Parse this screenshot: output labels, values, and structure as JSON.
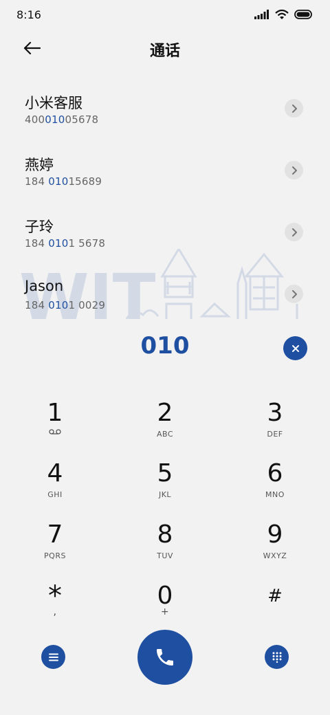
{
  "status": {
    "time": "8:16"
  },
  "header": {
    "title": "通话"
  },
  "contacts": [
    {
      "name": "小米客服",
      "number_parts": [
        "400",
        "010",
        "05678"
      ]
    },
    {
      "name": "燕婷",
      "number_parts": [
        "184 ",
        "010",
        "15689"
      ]
    },
    {
      "name": "子玲",
      "number_parts": [
        "184 ",
        "010",
        "1 5678"
      ]
    },
    {
      "name": "Jason",
      "number_parts": [
        "184 ",
        "010",
        "1 0029"
      ]
    }
  ],
  "watermark": {
    "text": "WIT"
  },
  "dialer": {
    "typed_number": "010",
    "keys": [
      {
        "digit": "1",
        "letters": "",
        "icon": "voicemail-icon"
      },
      {
        "digit": "2",
        "letters": "ABC"
      },
      {
        "digit": "3",
        "letters": "DEF"
      },
      {
        "digit": "4",
        "letters": "GHI"
      },
      {
        "digit": "5",
        "letters": "JKL"
      },
      {
        "digit": "6",
        "letters": "MNO"
      },
      {
        "digit": "7",
        "letters": "PQRS"
      },
      {
        "digit": "8",
        "letters": "TUV"
      },
      {
        "digit": "9",
        "letters": "WXYZ"
      },
      {
        "digit": "*",
        "letters": ","
      },
      {
        "digit": "0",
        "letters": "+"
      },
      {
        "digit": "#",
        "letters": ""
      }
    ]
  },
  "colors": {
    "accent": "#1f4fa0",
    "background": "#f2f2f2",
    "watermark": "#d3dae6"
  }
}
